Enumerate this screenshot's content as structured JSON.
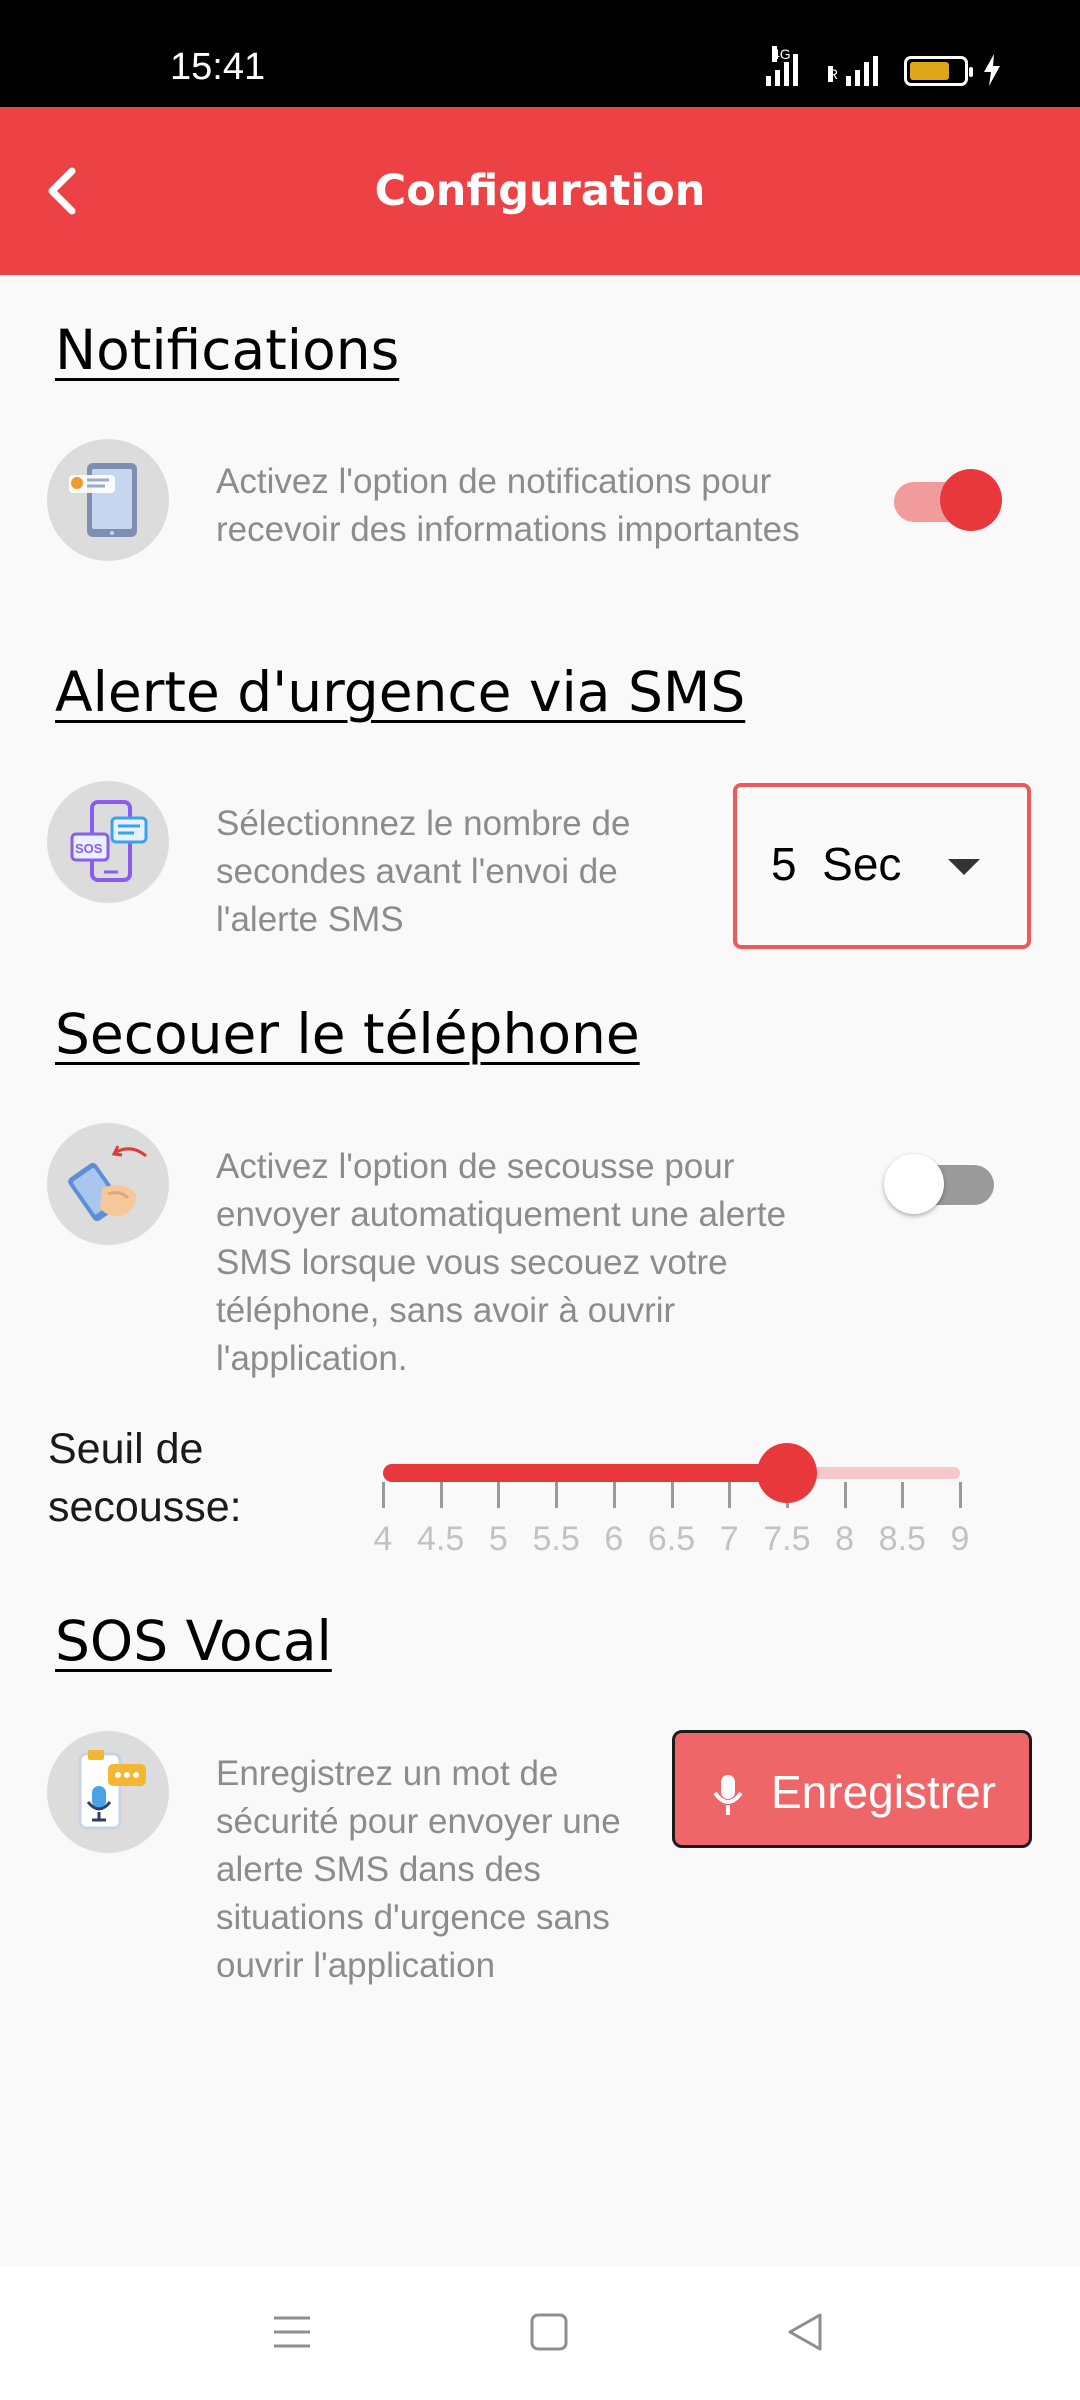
{
  "status_bar": {
    "time": "15:41",
    "network_label": "4G",
    "roaming_label": "R",
    "battery_level": 0.75,
    "charging": true,
    "battery_color": "#e0a619"
  },
  "app_bar": {
    "title": "Configuration",
    "back_icon": "chevron-left-icon",
    "color": "#ec4245"
  },
  "notifications": {
    "title": "Notifications",
    "icon": "tablet-notification-icon",
    "description": "Activez l'option de notifications pour recevoir des informations importantes",
    "enabled": true
  },
  "sms_alert": {
    "title": "Alerte d'urgence via SMS",
    "icon": "sos-phone-icon",
    "description": "Sélectionnez le nombre de secondes avant l'envoi de l'alerte SMS",
    "selected_delay": "5  Sec"
  },
  "shake": {
    "title": "Secouer le téléphone",
    "icon": "shake-phone-icon",
    "description": "Activez l'option de secousse pour envoyer automatiquement une alerte SMS lorsque vous secouez votre téléphone, sans avoir à ouvrir l'application.",
    "enabled": false,
    "threshold_label": "Seuil de secousse:",
    "threshold": {
      "min": 4,
      "max": 9,
      "step": 0.5,
      "value": 7.5,
      "ticks": [
        "4",
        "4.5",
        "5",
        "5.5",
        "6",
        "6.5",
        "7",
        "7.5",
        "8",
        "8.5",
        "9"
      ]
    }
  },
  "sos_vocal": {
    "title": "SOS Vocal",
    "icon": "voice-chat-icon",
    "description": "Enregistrez un mot de sécurité pour envoyer une alerte SMS dans des situations d'urgence sans ouvrir l'application",
    "record_button": "Enregistrer",
    "record_icon": "mic-icon"
  },
  "nav_bar": {
    "menu_icon": "menu-icon",
    "home_icon": "home-square-icon",
    "back_icon": "back-triangle-icon"
  },
  "colors": {
    "accent": "#ec4245",
    "accent_light": "#f5c9ca",
    "text_secondary": "#8c8c8c"
  }
}
